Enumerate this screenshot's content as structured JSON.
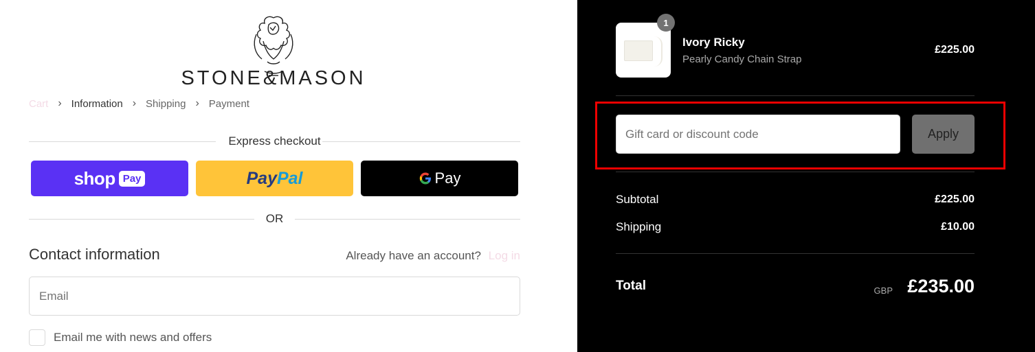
{
  "brand": {
    "name": "STONE&MASON"
  },
  "breadcrumb": {
    "items": [
      "Cart",
      "Information",
      "Shipping",
      "Payment"
    ]
  },
  "express": {
    "title": "Express checkout",
    "shop_word": "shop",
    "shop_pill": "Pay",
    "paypal_1": "Pay",
    "paypal_2": "Pal",
    "gpay_g": "G",
    "gpay_word": "Pay"
  },
  "or_label": "OR",
  "contact": {
    "title": "Contact information",
    "account_prompt": "Already have an account?",
    "login_label": "Log in",
    "email_placeholder": "Email",
    "newsletter_label": "Email me with news and offers"
  },
  "order": {
    "item": {
      "quantity": "1",
      "name": "Ivory Ricky",
      "variant": "Pearly Candy Chain Strap",
      "price": "£225.00"
    },
    "discount_placeholder": "Gift card or discount code",
    "apply_label": "Apply",
    "subtotal_label": "Subtotal",
    "subtotal_value": "£225.00",
    "shipping_label": "Shipping",
    "shipping_value": "£10.00",
    "total_label": "Total",
    "currency": "GBP",
    "total_value": "£235.00"
  },
  "colors": {
    "shop_pay": "#5a31f4",
    "paypal": "#ffc439",
    "gpay": "#000000",
    "highlight": "#ee0000",
    "apply_button": "#707070"
  },
  "icons": [
    "brand-crest-icon",
    "chevron-right-icon",
    "google-g-icon",
    "product-thumbnail"
  ]
}
